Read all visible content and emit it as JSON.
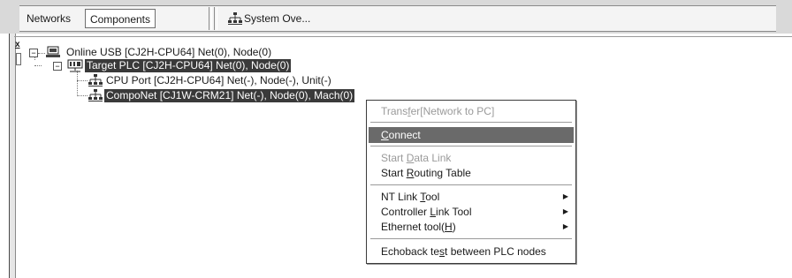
{
  "tabs": {
    "networks": "Networks",
    "components": "Components",
    "system": "System Ove..."
  },
  "pane": {
    "close_glyph": "x"
  },
  "tree": {
    "root": "Online USB  [CJ2H-CPU64] Net(0), Node(0)",
    "target": "Target PLC [CJ2H-CPU64] Net(0), Node(0)",
    "cpu_port": "CPU Port [CJ2H-CPU64] Net(-), Node(-), Unit(-)",
    "componet": "CompoNet [CJ1W-CRM21] Net(-), Node(0), Mach(0)"
  },
  "menu": {
    "transfer": {
      "pre": "Trans",
      "key": "f",
      "post": "er[Network to PC]"
    },
    "connect": {
      "pre": "",
      "key": "C",
      "post": "onnect"
    },
    "start_data_link": {
      "pre": "Start ",
      "key": "D",
      "post": "ata Link"
    },
    "start_routing": {
      "pre": "Start ",
      "key": "R",
      "post": "outing Table"
    },
    "nt_link": {
      "pre": "NT Link ",
      "key": "T",
      "post": "ool"
    },
    "controller_link": {
      "pre": "Controller ",
      "key": "L",
      "post": "ink Tool"
    },
    "ethernet": {
      "pre": "Ethernet tool(",
      "key": "H",
      "post": ")"
    },
    "echoback": {
      "pre": "Echoback te",
      "key": "s",
      "post": "t between PLC nodes"
    },
    "submenu_arrow": "▶"
  },
  "colors": {
    "selection": "#3a3a3a",
    "menu_highlight": "#6a6a6a",
    "disabled_text": "#9a9a9a"
  }
}
